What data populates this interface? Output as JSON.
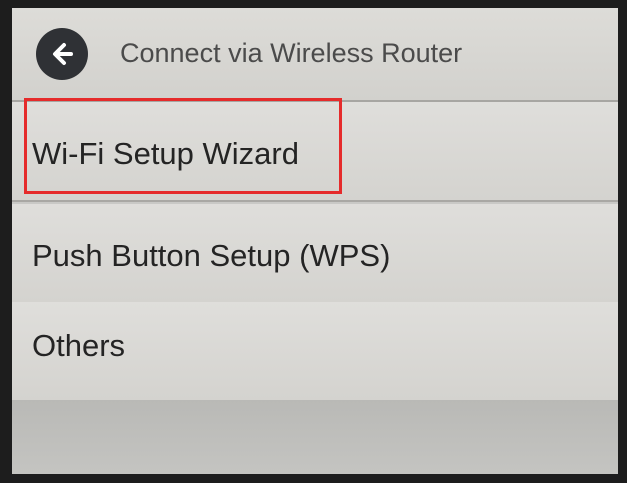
{
  "header": {
    "title": "Connect via Wireless Router",
    "back_icon": "arrow-left-icon"
  },
  "menu": {
    "items": [
      {
        "label": "Wi-Fi Setup Wizard"
      },
      {
        "label": "Push Button Setup (WPS)"
      },
      {
        "label": "Others"
      }
    ]
  },
  "annotation": {
    "highlight_color": "#e52b2b"
  },
  "colors": {
    "screen_bg": "#d6d5d1",
    "back_button": "#2f3135"
  }
}
